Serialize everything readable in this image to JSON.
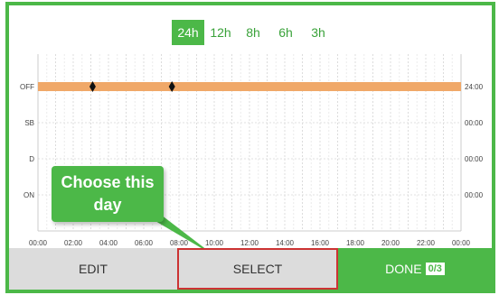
{
  "tabs": [
    "24h",
    "12h",
    "8h",
    "6h",
    "3h"
  ],
  "active_tab": "24h",
  "chart_data": {
    "type": "line",
    "rows": [
      "OFF",
      "SB",
      "D",
      "ON"
    ],
    "right_labels": [
      "24:00",
      "00:00",
      "00:00",
      "00:00"
    ],
    "x_ticks": [
      "00:00",
      "02:00",
      "04:00",
      "06:00",
      "08:00",
      "10:00",
      "12:00",
      "14:00",
      "16:00",
      "18:00",
      "20:00",
      "22:00",
      "00:00"
    ],
    "x_range_hours": [
      0,
      24
    ],
    "series": [
      {
        "status": "OFF",
        "start": 0,
        "end": 24,
        "color": "#f0a868"
      }
    ],
    "markers_hours": [
      3.1,
      7.6
    ],
    "grid": true
  },
  "callout": {
    "line1": "Choose this",
    "line2": "day"
  },
  "buttons": {
    "edit": "EDIT",
    "select": "SELECT",
    "done": "DONE",
    "done_count": "0/3"
  }
}
